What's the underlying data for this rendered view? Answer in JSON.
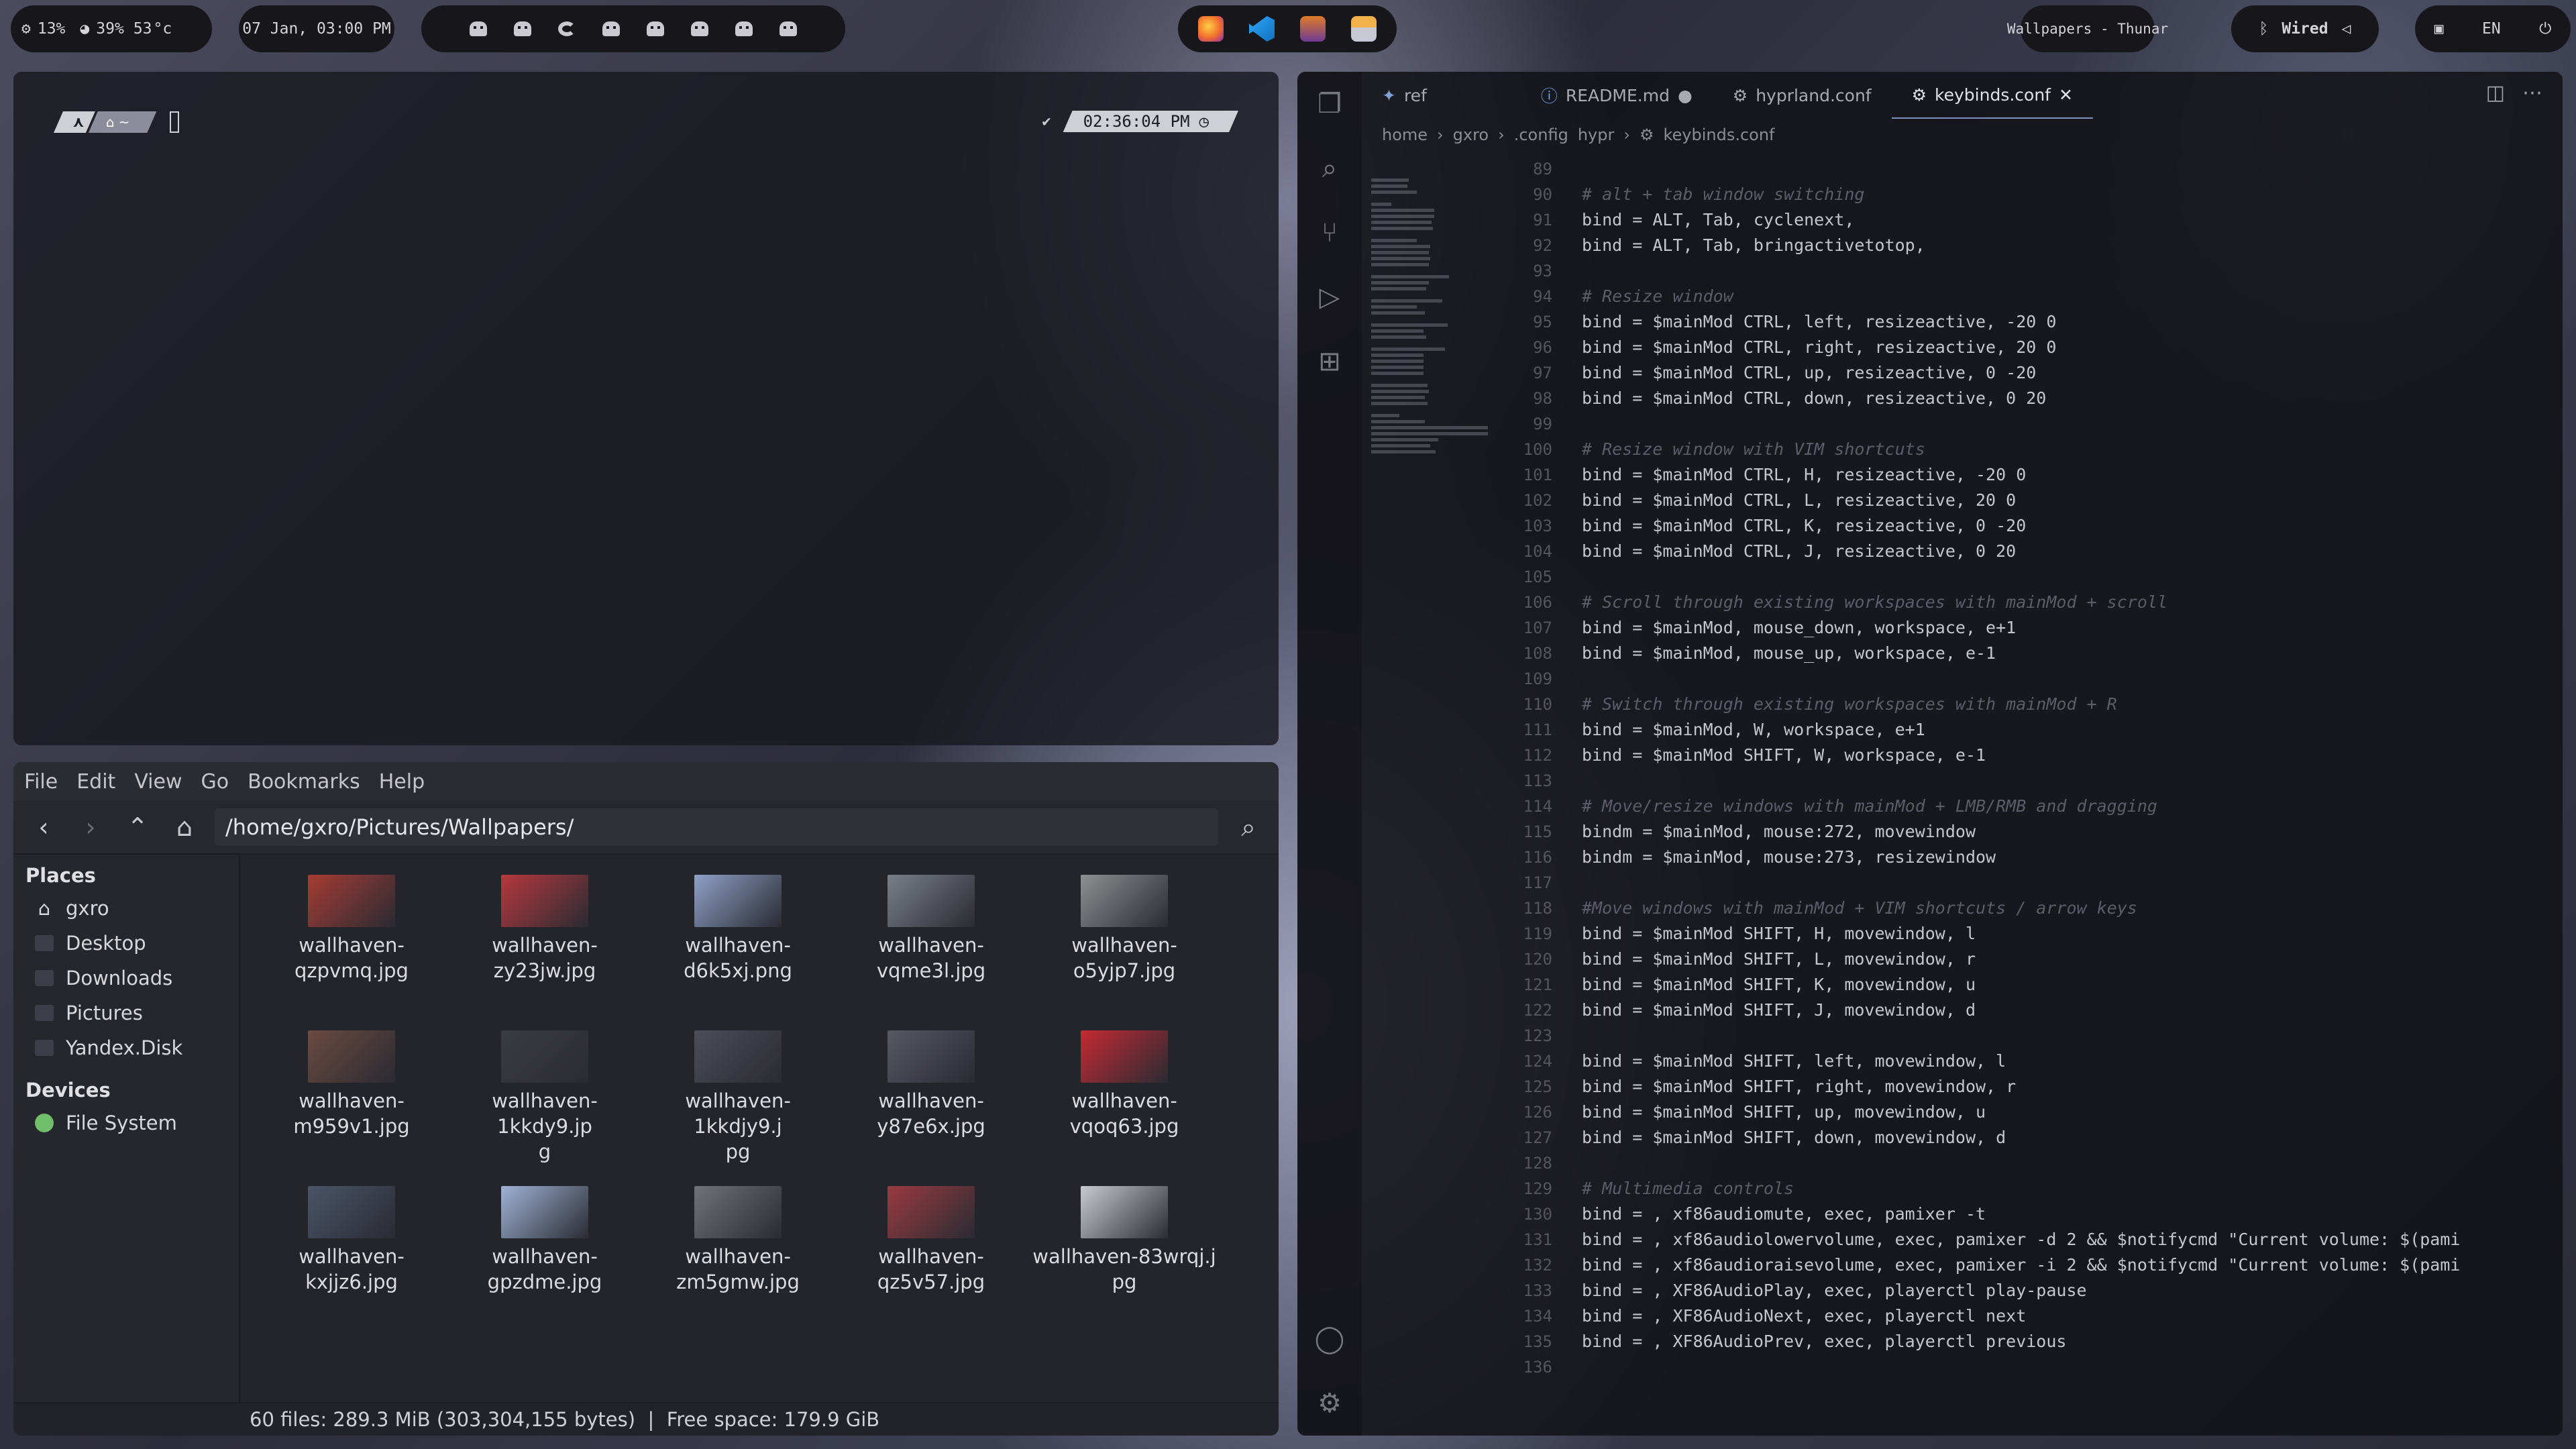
{
  "topbar": {
    "cpu": "13%",
    "memory": "39%",
    "temp": "53",
    "temp_unit": "°c",
    "datetime": "07 Jan, 03:00 PM",
    "window_title": "Wallpapers - Thunar",
    "network": "Wired",
    "language": "EN"
  },
  "terminal": {
    "home_glyph": "~",
    "clock": "02:36:04 PM"
  },
  "filemanager": {
    "menu": [
      "File",
      "Edit",
      "View",
      "Go",
      "Bookmarks",
      "Help"
    ],
    "path": "/home/gxro/Pictures/Wallpapers/",
    "places_header": "Places",
    "places": [
      "gxro",
      "Desktop",
      "Downloads",
      "Pictures",
      "Yandex.Disk"
    ],
    "devices_header": "Devices",
    "devices": [
      "File System"
    ],
    "files": [
      {
        "line1": "wallhaven-",
        "line2": "qzpvmq.jpg",
        "color": "#a73b33"
      },
      {
        "line1": "wallhaven-",
        "line2": "zy23jw.jpg",
        "color": "#b6383d"
      },
      {
        "line1": "wallhaven-",
        "line2": "d6k5xj.png",
        "color": "#8ea0c6"
      },
      {
        "line1": "wallhaven-",
        "line2": "vqme3l.jpg",
        "color": "#7a7f88"
      },
      {
        "line1": "wallhaven-",
        "line2": "o5yjp7.jpg",
        "color": "#8e8f92"
      },
      {
        "line1": "wallhaven-",
        "line2": "m959v1.jpg",
        "color": "#6b4a40"
      },
      {
        "line1": "wallhaven-1kkdy9.jp",
        "line2": "g",
        "color": "#3a3c44"
      },
      {
        "line1": "wallhaven-1kkdjy9.j",
        "line2": "pg",
        "color": "#4b4e57"
      },
      {
        "line1": "wallhaven-",
        "line2": "y87e6x.jpg",
        "color": "#565864"
      },
      {
        "line1": "wallhaven-",
        "line2": "vqoq63.jpg",
        "color": "#c42a33"
      },
      {
        "line1": "wallhaven-",
        "line2": "kxjjz6.jpg",
        "color": "#4a5468"
      },
      {
        "line1": "wallhaven-",
        "line2": "gpzdme.jpg",
        "color": "#9fb3d6"
      },
      {
        "line1": "wallhaven-",
        "line2": "zm5gmw.jpg",
        "color": "#707278"
      },
      {
        "line1": "wallhaven-",
        "line2": "qz5v57.jpg",
        "color": "#9a3a40"
      },
      {
        "line1": "wallhaven-83wrqj.j",
        "line2": "pg",
        "color": "#c8cad2"
      }
    ],
    "status": "60 files: 289.3 MiB (303,304,155 bytes)  |  Free space: 179.9 GiB"
  },
  "editor": {
    "tabs": [
      "ref",
      "README.md",
      "hyprland.conf",
      "keybinds.conf"
    ],
    "breadcrumb": [
      "home",
      "gxro",
      ".config",
      "hypr",
      "keybinds.conf"
    ],
    "first_line": 89,
    "lines": [
      "",
      "# alt + tab window switching",
      "bind = ALT, Tab, cyclenext,",
      "bind = ALT, Tab, bringactivetotop,",
      "",
      "# Resize window",
      "bind = $mainMod CTRL, left, resizeactive, -20 0",
      "bind = $mainMod CTRL, right, resizeactive, 20 0",
      "bind = $mainMod CTRL, up, resizeactive, 0 -20",
      "bind = $mainMod CTRL, down, resizeactive, 0 20",
      "",
      "# Resize window with VIM shortcuts",
      "bind = $mainMod CTRL, H, resizeactive, -20 0",
      "bind = $mainMod CTRL, L, resizeactive, 20 0",
      "bind = $mainMod CTRL, K, resizeactive, 0 -20",
      "bind = $mainMod CTRL, J, resizeactive, 0 20",
      "",
      "# Scroll through existing workspaces with mainMod + scroll",
      "bind = $mainMod, mouse_down, workspace, e+1",
      "bind = $mainMod, mouse_up, workspace, e-1",
      "",
      "# Switch through existing workspaces with mainMod + R",
      "bind = $mainMod, W, workspace, e+1",
      "bind = $mainMod SHIFT, W, workspace, e-1",
      "",
      "# Move/resize windows with mainMod + LMB/RMB and dragging",
      "bindm = $mainMod, mouse:272, movewindow",
      "bindm = $mainMod, mouse:273, resizewindow",
      "",
      "#Move windows with mainMod + VIM shortcuts / arrow keys",
      "bind = $mainMod SHIFT, H, movewindow, l",
      "bind = $mainMod SHIFT, L, movewindow, r",
      "bind = $mainMod SHIFT, K, movewindow, u",
      "bind = $mainMod SHIFT, J, movewindow, d",
      "",
      "bind = $mainMod SHIFT, left, movewindow, l",
      "bind = $mainMod SHIFT, right, movewindow, r",
      "bind = $mainMod SHIFT, up, movewindow, u",
      "bind = $mainMod SHIFT, down, movewindow, d",
      "",
      "# Multimedia controls",
      "bind = , xf86audiomute, exec, pamixer -t",
      "bind = , xf86audiolowervolume, exec, pamixer -d 2 && $notifycmd \"Current volume: $(pami",
      "bind = , xf86audioraisevolume, exec, pamixer -i 2 && $notifycmd \"Current volume: $(pami",
      "bind = , XF86AudioPlay, exec, playerctl play-pause",
      "bind = , XF86AudioNext, exec, playerctl next",
      "bind = , XF86AudioPrev, exec, playerctl previous",
      ""
    ]
  }
}
